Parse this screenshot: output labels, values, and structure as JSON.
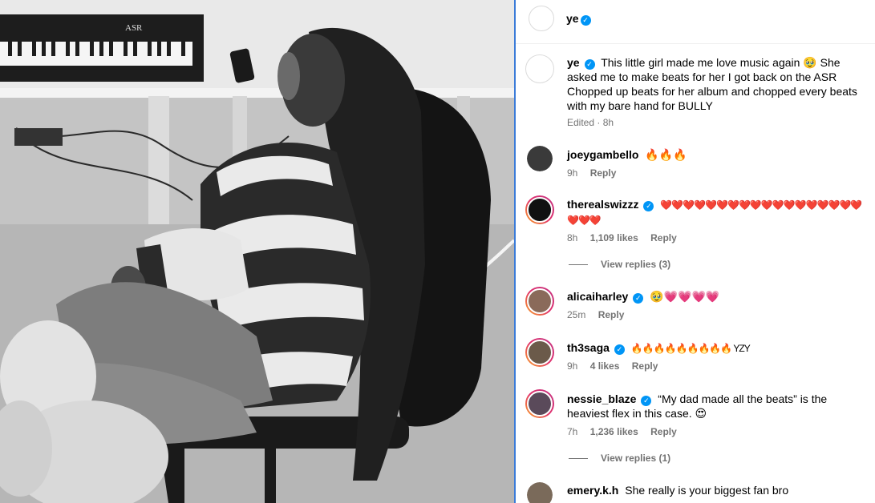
{
  "post": {
    "author": "ye",
    "author_verified": true,
    "caption": "This little girl made me love music again 🥹 She asked me to make beats for her I got back on the ASR Chopped up beats for her album and chopped every beats with my bare hand for BULLY",
    "caption_meta": "Edited · 8h",
    "photo_keyboard_label": "ASR"
  },
  "comments": [
    {
      "user": "joeygambello",
      "verified": false,
      "text": "🔥🔥🔥",
      "time": "9h",
      "likes": "",
      "reply": "Reply",
      "avatar_color": "#3a3a3a",
      "ring": false
    },
    {
      "user": "therealswizzz",
      "verified": true,
      "text": "❤️❤️❤️❤️❤️❤️❤️❤️❤️❤️❤️❤️❤️❤️❤️❤️❤️❤️❤️❤️❤️",
      "time": "8h",
      "likes": "1,109 likes",
      "reply": "Reply",
      "view_replies": "View replies (3)",
      "avatar_color": "#111111",
      "ring": true
    },
    {
      "user": "alicaiharley",
      "verified": true,
      "text": "🥹💗💗💗💗",
      "time": "25m",
      "likes": "",
      "reply": "Reply",
      "avatar_color": "#8a6a5a",
      "ring": true
    },
    {
      "user": "th3saga",
      "verified": true,
      "text": "🔥🔥🔥🔥🔥🔥🔥🔥🔥 YZY",
      "time": "9h",
      "likes": "4 likes",
      "reply": "Reply",
      "avatar_color": "#6b5a4a",
      "ring": true
    },
    {
      "user": "nessie_blaze",
      "verified": true,
      "text": "“My dad made all the beats” is the heaviest flex in this case. 😍",
      "time": "7h",
      "likes": "1,236 likes",
      "reply": "Reply",
      "view_replies": "View replies (1)",
      "avatar_color": "#5a4a5a",
      "ring": true
    },
    {
      "user": "emery.k.h",
      "verified": false,
      "text": "She really is your biggest fan bro",
      "time": "",
      "likes": "",
      "reply": "",
      "avatar_color": "#7a6a5a",
      "ring": false
    }
  ],
  "colors": {
    "accent": "#0095f6",
    "divider": "#3b7bd8",
    "muted": "#737373"
  }
}
